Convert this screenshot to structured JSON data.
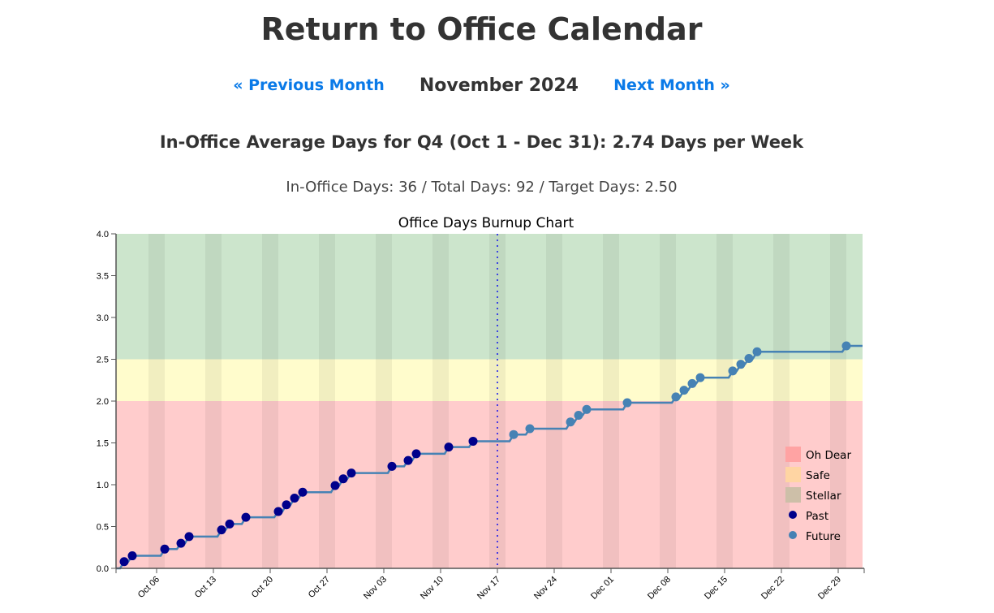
{
  "page": {
    "title": "Return to Office Calendar",
    "nav": {
      "prev_label": "« Previous Month",
      "current_month": "November 2024",
      "next_label": "Next Month »"
    },
    "average_line": "In-Office Average Days for Q4 (Oct 1 - Dec 31): 2.74 Days per Week",
    "stats_line": "In-Office Days: 36 / Total Days: 92 / Target Days: 2.50"
  },
  "chart_data": {
    "type": "line",
    "title": "Office Days Burnup Chart",
    "xlabel": "",
    "ylabel": "",
    "x_start": "2024-10-01",
    "x_end": "2024-12-31",
    "ylim": [
      0,
      4.0
    ],
    "yticks": [
      "0.0",
      "0.5",
      "1.0",
      "1.5",
      "2.0",
      "2.5",
      "3.0",
      "3.5",
      "4.0"
    ],
    "ytick_values": [
      0,
      0.5,
      1.0,
      1.5,
      2.0,
      2.5,
      3.0,
      3.5,
      4.0
    ],
    "xticks": [
      {
        "date": "2024-10-06",
        "label": "Oct 06"
      },
      {
        "date": "2024-10-13",
        "label": "Oct 13"
      },
      {
        "date": "2024-10-20",
        "label": "Oct 20"
      },
      {
        "date": "2024-10-27",
        "label": "Oct 27"
      },
      {
        "date": "2024-11-03",
        "label": "Nov 03"
      },
      {
        "date": "2024-11-10",
        "label": "Nov 10"
      },
      {
        "date": "2024-11-17",
        "label": "Nov 17"
      },
      {
        "date": "2024-11-24",
        "label": "Nov 24"
      },
      {
        "date": "2024-12-01",
        "label": "Dec 01"
      },
      {
        "date": "2024-12-08",
        "label": "Dec 08"
      },
      {
        "date": "2024-12-15",
        "label": "Dec 15"
      },
      {
        "date": "2024-12-22",
        "label": "Dec 22"
      },
      {
        "date": "2024-12-29",
        "label": "Dec 29"
      }
    ],
    "today_marker": "2024-11-17",
    "weekend_shading": true,
    "zones": [
      {
        "name": "Oh Dear",
        "from": 0,
        "to": 2.0,
        "color": "#ffcccc",
        "legend_color": "#ffa3a3"
      },
      {
        "name": "Safe",
        "from": 2.0,
        "to": 2.5,
        "color": "#fffccc",
        "legend_color": "#ffd5a3"
      },
      {
        "name": "Stellar",
        "from": 2.5,
        "to": 4.0,
        "color": "#cce5cc",
        "legend_color": "#cdbfa8"
      }
    ],
    "legend": {
      "placement": "bottom-right",
      "items": [
        {
          "label": "Oh Dear",
          "type": "swatch",
          "color": "#ffa3a3"
        },
        {
          "label": "Safe",
          "type": "swatch",
          "color": "#ffd5a3"
        },
        {
          "label": "Stellar",
          "type": "swatch",
          "color": "#cdbfa8"
        },
        {
          "label": "Past",
          "type": "dot",
          "color": "#00008b"
        },
        {
          "label": "Future",
          "type": "dot",
          "color": "#4682b4"
        }
      ]
    },
    "line_color": "#4682b4",
    "series": [
      {
        "name": "Past",
        "color": "#00008b",
        "points": [
          {
            "date": "2024-10-02",
            "value": 0.08
          },
          {
            "date": "2024-10-03",
            "value": 0.15
          },
          {
            "date": "2024-10-07",
            "value": 0.23
          },
          {
            "date": "2024-10-09",
            "value": 0.3
          },
          {
            "date": "2024-10-10",
            "value": 0.38
          },
          {
            "date": "2024-10-14",
            "value": 0.46
          },
          {
            "date": "2024-10-15",
            "value": 0.53
          },
          {
            "date": "2024-10-17",
            "value": 0.61
          },
          {
            "date": "2024-10-21",
            "value": 0.68
          },
          {
            "date": "2024-10-22",
            "value": 0.76
          },
          {
            "date": "2024-10-23",
            "value": 0.84
          },
          {
            "date": "2024-10-24",
            "value": 0.91
          },
          {
            "date": "2024-10-28",
            "value": 0.99
          },
          {
            "date": "2024-10-29",
            "value": 1.07
          },
          {
            "date": "2024-10-30",
            "value": 1.14
          },
          {
            "date": "2024-11-04",
            "value": 1.22
          },
          {
            "date": "2024-11-06",
            "value": 1.29
          },
          {
            "date": "2024-11-07",
            "value": 1.37
          },
          {
            "date": "2024-11-11",
            "value": 1.45
          },
          {
            "date": "2024-11-14",
            "value": 1.52
          }
        ]
      },
      {
        "name": "Future",
        "color": "#4682b4",
        "points": [
          {
            "date": "2024-11-19",
            "value": 1.6
          },
          {
            "date": "2024-11-21",
            "value": 1.67
          },
          {
            "date": "2024-11-26",
            "value": 1.75
          },
          {
            "date": "2024-11-27",
            "value": 1.83
          },
          {
            "date": "2024-11-28",
            "value": 1.9
          },
          {
            "date": "2024-12-03",
            "value": 1.98
          },
          {
            "date": "2024-12-09",
            "value": 2.05
          },
          {
            "date": "2024-12-10",
            "value": 2.13
          },
          {
            "date": "2024-12-11",
            "value": 2.21
          },
          {
            "date": "2024-12-12",
            "value": 2.28
          },
          {
            "date": "2024-12-16",
            "value": 2.36
          },
          {
            "date": "2024-12-17",
            "value": 2.44
          },
          {
            "date": "2024-12-18",
            "value": 2.51
          },
          {
            "date": "2024-12-19",
            "value": 2.59
          },
          {
            "date": "2024-12-30",
            "value": 2.66
          }
        ]
      }
    ]
  }
}
